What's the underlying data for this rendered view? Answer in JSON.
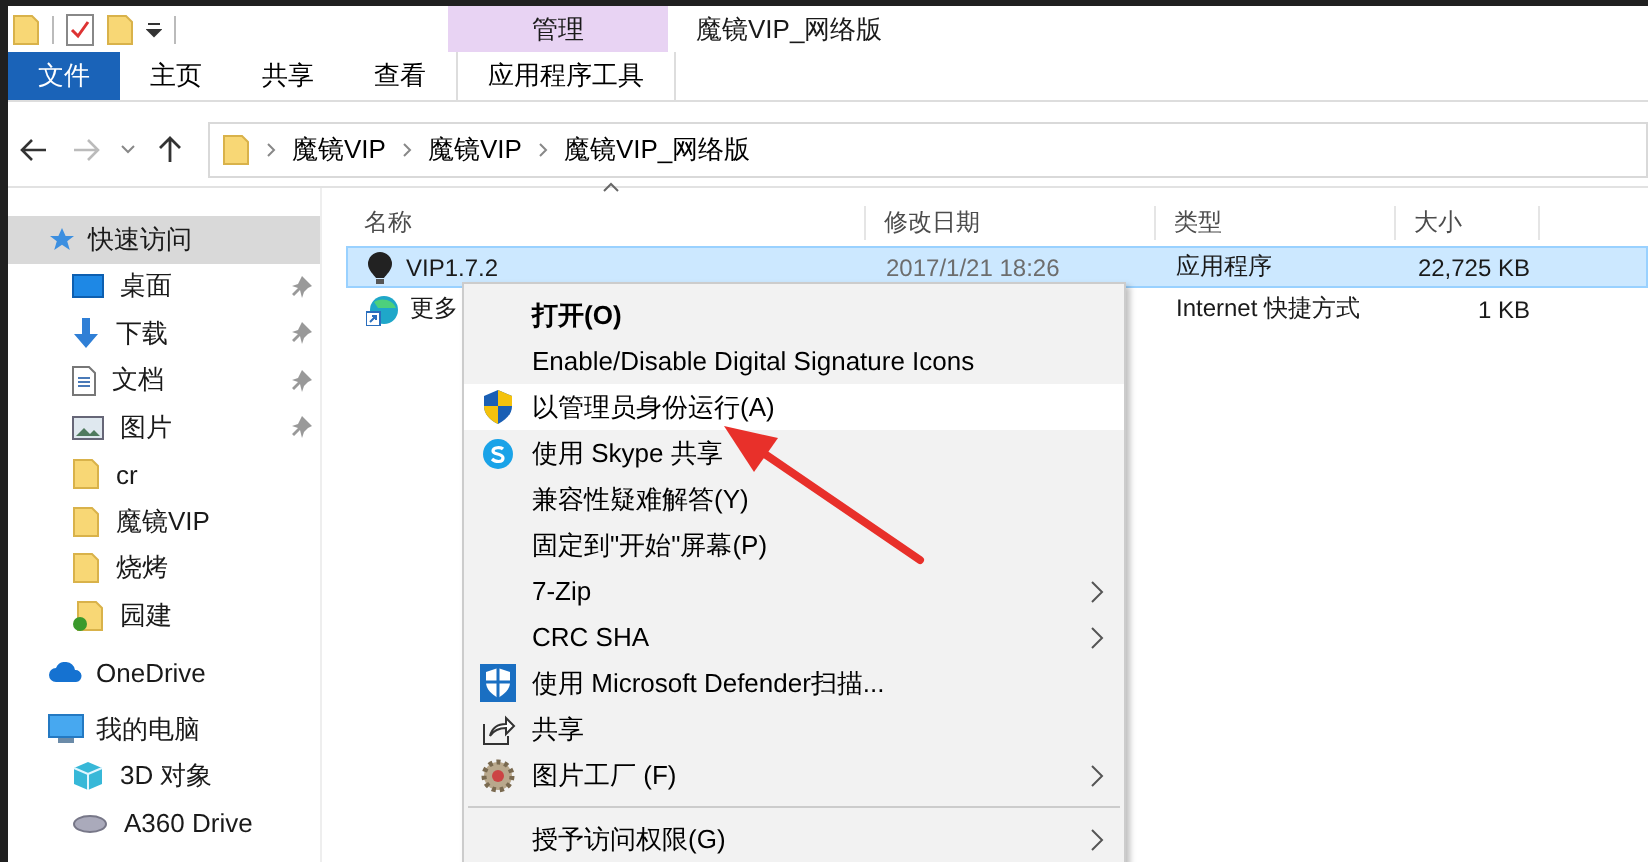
{
  "window": {
    "title": "魔镜VIP_网络版",
    "context_tab_header": "管理"
  },
  "ribbon_tabs": [
    {
      "label": "文件",
      "kind": "file",
      "selected": false
    },
    {
      "label": "主页",
      "kind": "tab",
      "selected": false
    },
    {
      "label": "共享",
      "kind": "tab",
      "selected": false
    },
    {
      "label": "查看",
      "kind": "tab",
      "selected": false
    },
    {
      "label": "应用程序工具",
      "kind": "context",
      "selected": false
    }
  ],
  "breadcrumb": [
    "魔镜VIP",
    "魔镜VIP",
    "魔镜VIP_网络版"
  ],
  "sidebar": {
    "items": [
      {
        "label": "快速访问",
        "kind": "star",
        "selected": true,
        "children": [
          {
            "label": "桌面",
            "kind": "desktop",
            "pinned": true
          },
          {
            "label": "下载",
            "kind": "download",
            "pinned": true
          },
          {
            "label": "文档",
            "kind": "document",
            "pinned": true
          },
          {
            "label": "图片",
            "kind": "pictures",
            "pinned": true
          },
          {
            "label": "cr",
            "kind": "folder",
            "pinned": false
          },
          {
            "label": "魔镜VIP",
            "kind": "folder",
            "pinned": false
          },
          {
            "label": "烧烤",
            "kind": "folder",
            "pinned": false
          },
          {
            "label": "园建",
            "kind": "synced",
            "pinned": false
          }
        ]
      },
      {
        "label": "OneDrive",
        "kind": "cloud",
        "selected": false
      },
      {
        "label": "我的电脑",
        "kind": "computer",
        "selected": false,
        "children": [
          {
            "label": "3D 对象",
            "kind": "cube",
            "pinned": false
          },
          {
            "label": "A360 Drive",
            "kind": "drive",
            "pinned": false
          }
        ]
      }
    ]
  },
  "file_list": {
    "columns": [
      "名称",
      "修改日期",
      "类型",
      "大小"
    ],
    "rows": [
      {
        "name": "VIP1.7.2",
        "kind": "app",
        "modified": "2017/1/21 18:26",
        "type": "应用程序",
        "size": "22,725 KB",
        "selected": true
      },
      {
        "name": "更多",
        "kind": "shortcut",
        "type": "Internet 快捷方式",
        "size": "1 KB",
        "selected": false
      }
    ]
  },
  "context_menu": {
    "items": [
      {
        "label": "打开(O)",
        "kind": "plain",
        "bold": true,
        "selected": false
      },
      {
        "label": "Enable/Disable Digital Signature Icons",
        "kind": "plain",
        "selected": false
      },
      {
        "label": "以管理员身份运行(A)",
        "kind": "shield",
        "selected": true
      },
      {
        "label": "使用 Skype 共享",
        "kind": "skype",
        "selected": false
      },
      {
        "label": "兼容性疑难解答(Y)",
        "kind": "plain",
        "selected": false
      },
      {
        "label": "固定到\"开始\"屏幕(P)",
        "kind": "plain",
        "selected": false
      },
      {
        "label": "7-Zip",
        "kind": "plain",
        "submenu": true,
        "selected": false
      },
      {
        "label": "CRC SHA",
        "kind": "plain",
        "submenu": true,
        "selected": false
      },
      {
        "label": "使用 Microsoft Defender扫描...",
        "kind": "defender",
        "selected": false
      },
      {
        "label": "共享",
        "kind": "share",
        "selected": false
      },
      {
        "label": "图片工厂 (F)",
        "kind": "gear",
        "submenu": true,
        "selected": false
      },
      {
        "label": "授予访问权限(G)",
        "kind": "plain",
        "submenu": true,
        "separator_before": true,
        "selected": false
      }
    ]
  }
}
